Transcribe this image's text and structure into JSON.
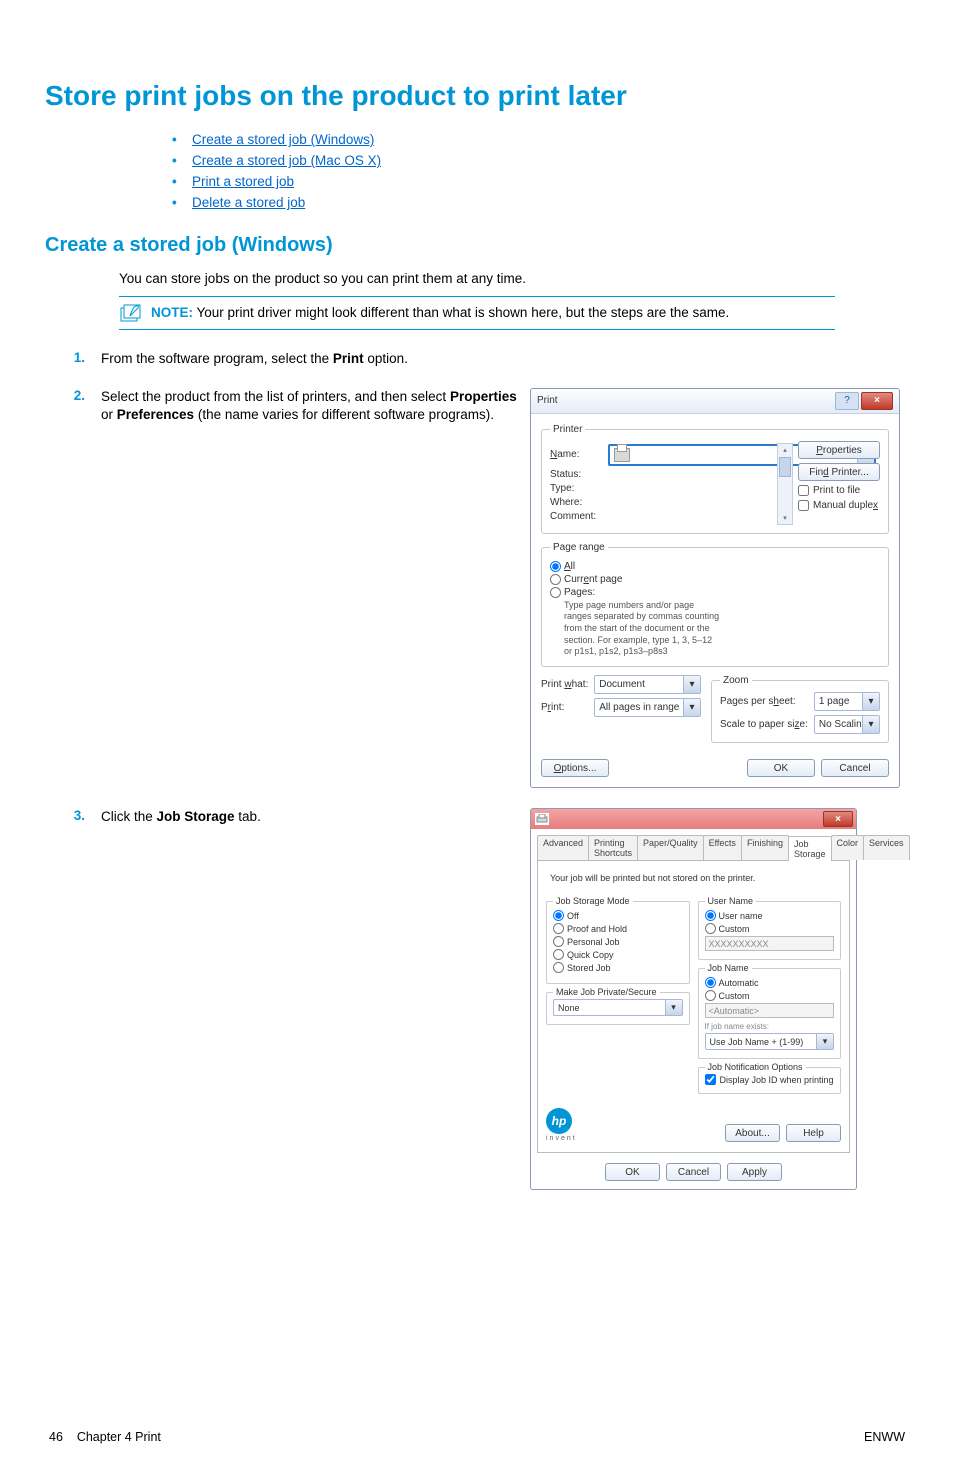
{
  "title": "Store print jobs on the product to print later",
  "toc": [
    "Create a stored job (Windows)",
    "Create a stored job (Mac OS X)",
    "Print a stored job",
    "Delete a stored job"
  ],
  "section_heading": "Create a stored job (Windows)",
  "intro": "You can store jobs on the product so you can print them at any time.",
  "note_label": "NOTE:",
  "note_text": "Your print driver might look different than what is shown here, but the steps are the same.",
  "steps": {
    "s1": {
      "num": "1.",
      "pre": "From the software program, select the ",
      "bold": "Print",
      "post": " option."
    },
    "s2": {
      "num": "2.",
      "pre": "Select the product from the list of printers, and then select ",
      "b1": "Properties",
      "mid": " or ",
      "b2": "Preferences",
      "post": " (the name varies for different software programs)."
    },
    "s3": {
      "num": "3.",
      "pre": "Click the ",
      "bold": "Job Storage",
      "post": " tab."
    }
  },
  "print_dialog": {
    "title": "Print",
    "printer_legend": "Printer",
    "name_lbl": "Name:",
    "status_lbl": "Status:",
    "type_lbl": "Type:",
    "where_lbl": "Where:",
    "comment_lbl": "Comment:",
    "properties_btn": "Properties",
    "find_printer_btn": "Find Printer...",
    "print_to_file": "Print to file",
    "manual_duplex": "Manual duplex",
    "range_legend": "Page range",
    "all": "All",
    "current": "Current page",
    "pages": "Pages:",
    "range_hint1": "Type page numbers and/or page",
    "range_hint2": "ranges separated by commas counting",
    "range_hint3": "from the start of the document or the",
    "range_hint4": "section. For example, type 1, 3, 5–12",
    "range_hint5": "or p1s1, p1s2, p1s3–p8s3",
    "pw_lbl": "Print what:",
    "pw_val": "Document",
    "pr_lbl": "Print:",
    "pr_val": "All pages in range",
    "zoom_legend": "Zoom",
    "pps_lbl": "Pages per sheet:",
    "pps_val": "1 page",
    "scale_lbl": "Scale to paper size:",
    "scale_val": "No Scaling",
    "options_btn": "Options...",
    "ok_btn": "OK",
    "cancel_btn": "Cancel"
  },
  "props_dialog": {
    "tabs": [
      "Advanced",
      "Printing Shortcuts",
      "Paper/Quality",
      "Effects",
      "Finishing",
      "Job Storage",
      "Color",
      "Services"
    ],
    "active_tab": "Job Storage",
    "note": "Your job will be printed but not stored on the printer.",
    "mode_title": "Job Storage Mode",
    "modes": [
      "Off",
      "Proof and Hold",
      "Personal Job",
      "Quick Copy",
      "Stored Job"
    ],
    "private_title": "Make Job Private/Secure",
    "private_val": "None",
    "user_title": "User Name",
    "user_r1": "User name",
    "user_r2": "Custom",
    "user_val": "XXXXXXXXXX",
    "job_title": "Job Name",
    "job_r1": "Automatic",
    "job_r2": "Custom",
    "job_val": "<Automatic>",
    "job_exists": "If job name exists:",
    "job_exists_val": "Use Job Name + (1-99)",
    "notif_title": "Job Notification Options",
    "notif_chk": "Display Job ID when printing",
    "hp": "hp",
    "invent": "invent",
    "about_btn": "About...",
    "help_btn": "Help",
    "ok_btn": "OK",
    "cancel_btn": "Cancel",
    "apply_btn": "Apply"
  },
  "footer": {
    "page": "46",
    "chapter": "Chapter 4   Print",
    "right": "ENWW"
  }
}
